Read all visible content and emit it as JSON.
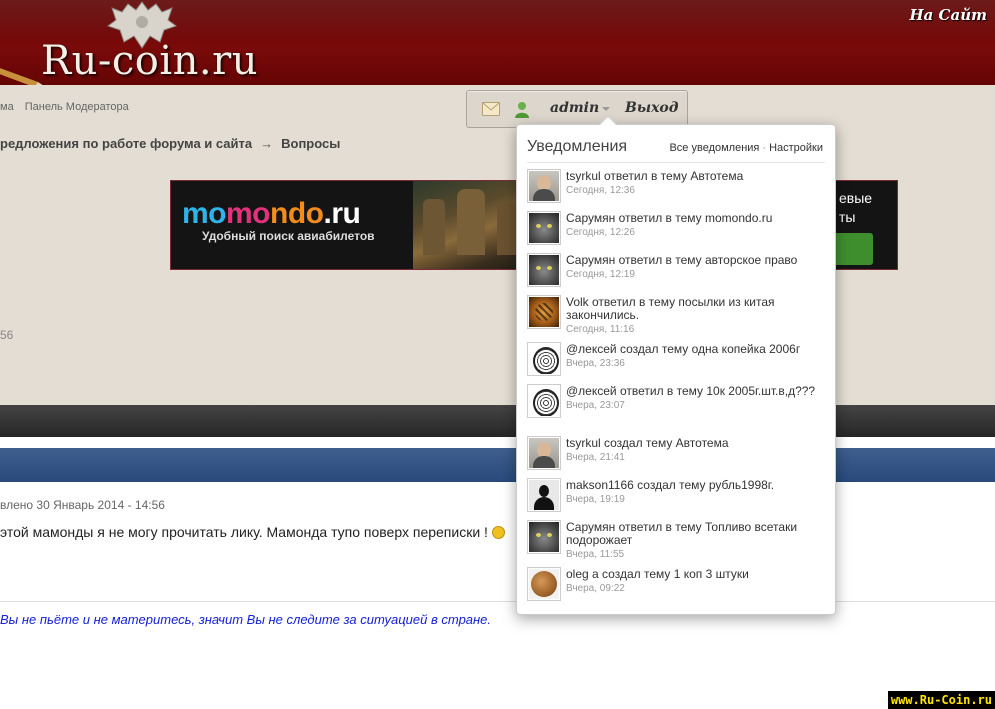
{
  "site": {
    "logo_text": "Ru-coin.ru",
    "to_site_link": "На Сайт"
  },
  "modbar": {
    "items": [
      "ма",
      "Панель Модератора"
    ]
  },
  "breadcrumb": {
    "parent": "редложения по работе форума и сайта",
    "arrow": "→",
    "current": "Вопросы"
  },
  "userbar": {
    "username": "admin",
    "logout": "Выход"
  },
  "banner": {
    "brand_parts": [
      "mo",
      "mo",
      "ndo",
      ".ru"
    ],
    "slogan": "Удобный поиск авиабилетов",
    "side_line1": "евые",
    "side_line2": "ты"
  },
  "page": {
    "stray_number": "56",
    "posted": "влено 30 Январь 2014 - 14:56",
    "message": "этой мамонды я не могу прочитать лику. Мамонда тупо поверх переписки !",
    "signature": "Вы не пьёте и не материтесь, значит Вы не следите за ситуацией в стране.",
    "watermark": "www.Ru-Coin.ru"
  },
  "notifications": {
    "title": "Уведомления",
    "all_link": "Все уведомления",
    "separator": "·",
    "settings_link": "Настройки",
    "items": [
      {
        "avatar": "person",
        "text": "tsyrkul ответил в тему Автотема",
        "time": "Сегодня, 12:36"
      },
      {
        "avatar": "cat",
        "text": "Сарумян ответил в тему momondo.ru",
        "time": "Сегодня, 12:26"
      },
      {
        "avatar": "cat",
        "text": "Сарумян ответил в тему авторское право",
        "time": "Сегодня, 12:19"
      },
      {
        "avatar": "tiger",
        "text": "Volk ответил в тему посылки из китая закончились.",
        "time": "Сегодня, 11:16"
      },
      {
        "avatar": "lion",
        "text": "@лексей создал тему одна копейка 2006г",
        "time": "Вчера, 23:36"
      },
      {
        "avatar": "lion",
        "text": "@лексей ответил в тему 10к 2005г.шт.в,д???",
        "time": "Вчера, 23:07"
      },
      {
        "avatar": "person",
        "text": "tsyrkul создал тему Автотема",
        "time": "Вчера, 21:41"
      },
      {
        "avatar": "default",
        "text": "makson1166 создал тему рубль1998г.",
        "time": "Вчера, 19:19"
      },
      {
        "avatar": "cat",
        "text": "Сарумян ответил в тему Топливо всетаки подорожает",
        "time": "Вчера, 11:55"
      },
      {
        "avatar": "coin",
        "text": "oleg а создал тему 1 коп 3 штуки",
        "time": "Вчера, 09:22"
      }
    ]
  },
  "colors": {
    "header_red": "#6e0505",
    "beige": "#e3ddd3",
    "blue_bar": "#28497a",
    "signature_blue": "#1420d8"
  }
}
